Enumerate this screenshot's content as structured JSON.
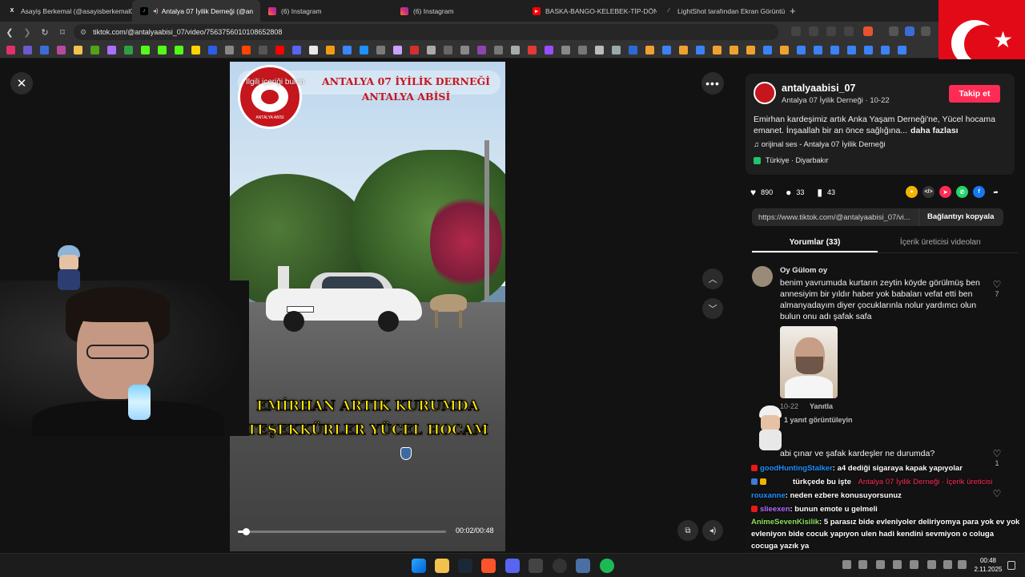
{
  "browser": {
    "tabs": [
      {
        "label": "Asayiş Berkemal (@asayisberkemal0",
        "icon": "x-logo-icon",
        "active": false
      },
      {
        "label": "Antalya 07 İyilik Derneği (@an",
        "icon": "tiktok-icon",
        "active": true
      },
      {
        "label": "(6) Instagram",
        "icon": "instagram-icon",
        "active": false
      },
      {
        "label": "(6) Instagram",
        "icon": "instagram-icon",
        "active": false
      },
      {
        "label": "BASKA-BANGO-KELEBEK-TİP-DÖNEK",
        "icon": "youtube-icon",
        "active": false
      },
      {
        "label": "LightShot tarafından Ekran Görüntüs",
        "icon": "lightshot-icon",
        "active": false
      }
    ],
    "new_tab": "+",
    "url": "tiktok.com/@antalyaabisi_07/video/7563756010108652808"
  },
  "video": {
    "report_label": "İlgili içeriği bulun",
    "header_line1": "ANTALYA 07 İYİLİK DERNEĞİ",
    "header_line2": "ANTALYA ABİSİ",
    "logo_text": "ANTALYA ABİSİ",
    "caption1": "EMİRHAN ARTIK KURUMDA",
    "caption2": "TEŞEKKÜRLER YÜCEL HOCAM",
    "progress": 0.04,
    "time": "00:02/00:48"
  },
  "post": {
    "username": "antalyaabisi_07",
    "subline": "Antalya 07 İyilik Derneği · 10-22",
    "follow_label": "Takip et",
    "description": "Emirhan kardeşimiz artık Anka Yaşam Derneği'ne, Yücel hocama emanet. İnşaallah bir an önce sağlığına...",
    "more_label": "daha fazlası",
    "music": "♫  orijinal ses - Antalya 07 İyilik Derneği",
    "location": "Türkiye · Diyarbakır",
    "likes": "890",
    "comments": "33",
    "saves": "43",
    "link": "https://www.tiktok.com/@antalyaabisi_07/vi...",
    "copy_label": "Bağlantıyı kopyala",
    "tab_comments": "Yorumlar (33)",
    "tab_creator": "İçerik üreticisi videoları"
  },
  "comments": [
    {
      "name": "Oy Gülom oy",
      "text": "benim yavrumuda kurtarın zeytin köyde görülmüş ben annesiyim bir yıldır haber yok babaları vefat etti ben almanyadayım diyer çocuklarınla nolur yardımcı olun bulun onu adı şafak safa",
      "likes": "7",
      "date": "10-22",
      "reply_label": "Yanıtla",
      "view_replies": "1 yanıt görüntüleyin"
    },
    {
      "name": "",
      "text": "abi çınar ve şafak kardeşler ne durumda?",
      "likes": "1"
    }
  ],
  "chat": [
    {
      "user": "goodHuntingStalker",
      "msg": ": a4 dediği sigaraya kapak yapıyolar"
    },
    {
      "user": "",
      "msg": "türkçede bu işte",
      "creator_tag": "Antalya 07 İyilik Derneği · İçerik üreticisi"
    },
    {
      "user": "rouxanne",
      "msg": ": neden ezbere konusuyorsunuz"
    },
    {
      "user": "slieexen",
      "msg": ": bunun emote u gelmeli"
    },
    {
      "user": "AnimeSevenKisilik",
      "msg": ": 5 parasız bide evleniyoler deliriyomya para yok ev yok evleniyon bide cocuk yapıyon ulen hadi kendini sevmiyon o coluga cocuga yazık ya"
    }
  ],
  "taskbar": {
    "time": "00:48",
    "date": "2.11.2025"
  }
}
